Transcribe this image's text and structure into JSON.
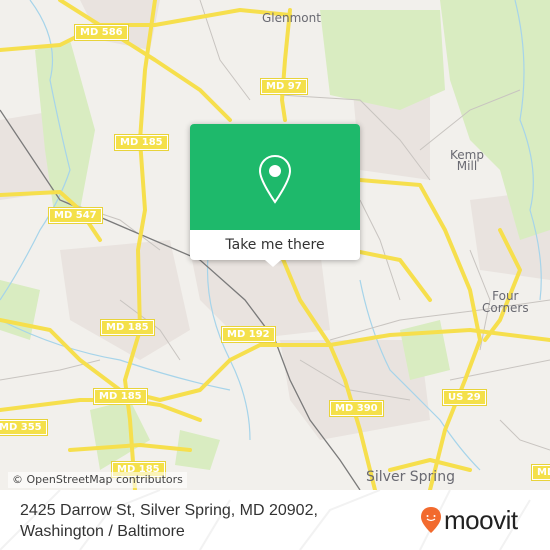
{
  "map": {
    "road_shields": [
      {
        "label": "MD 586"
      },
      {
        "label": "MD 97"
      },
      {
        "label": "MD 185"
      },
      {
        "label": "MD 547"
      },
      {
        "label": "MD 185"
      },
      {
        "label": "MD 192"
      },
      {
        "label": "MD 185"
      },
      {
        "label": "MD 355"
      },
      {
        "label": "MD 185"
      },
      {
        "label": "MD 390"
      },
      {
        "label": "US 29"
      },
      {
        "label": "MD"
      }
    ],
    "places": {
      "glenmont": "Glenmont",
      "kemp_mill": "Kemp\nMill",
      "four_corners": "Four\nCorners",
      "silver_spring": "Silver Spring"
    },
    "attribution": "© OpenStreetMap contributors",
    "colors": {
      "background": "#f2f0ec",
      "park": "#d8ecc0",
      "road": "#f7e24f",
      "residential": "#e8e2de",
      "water": "#9fd0e8",
      "rail": "#777777"
    }
  },
  "popup": {
    "icon": "map-pin-icon",
    "button_label": "Take me there",
    "color": "#1eb96b"
  },
  "footer": {
    "address_line1": "2425 Darrow St, Silver Spring, MD 20902,",
    "address_line2": "Washington / Baltimore",
    "brand": "moovit",
    "brand_color": "#f26a2e"
  }
}
